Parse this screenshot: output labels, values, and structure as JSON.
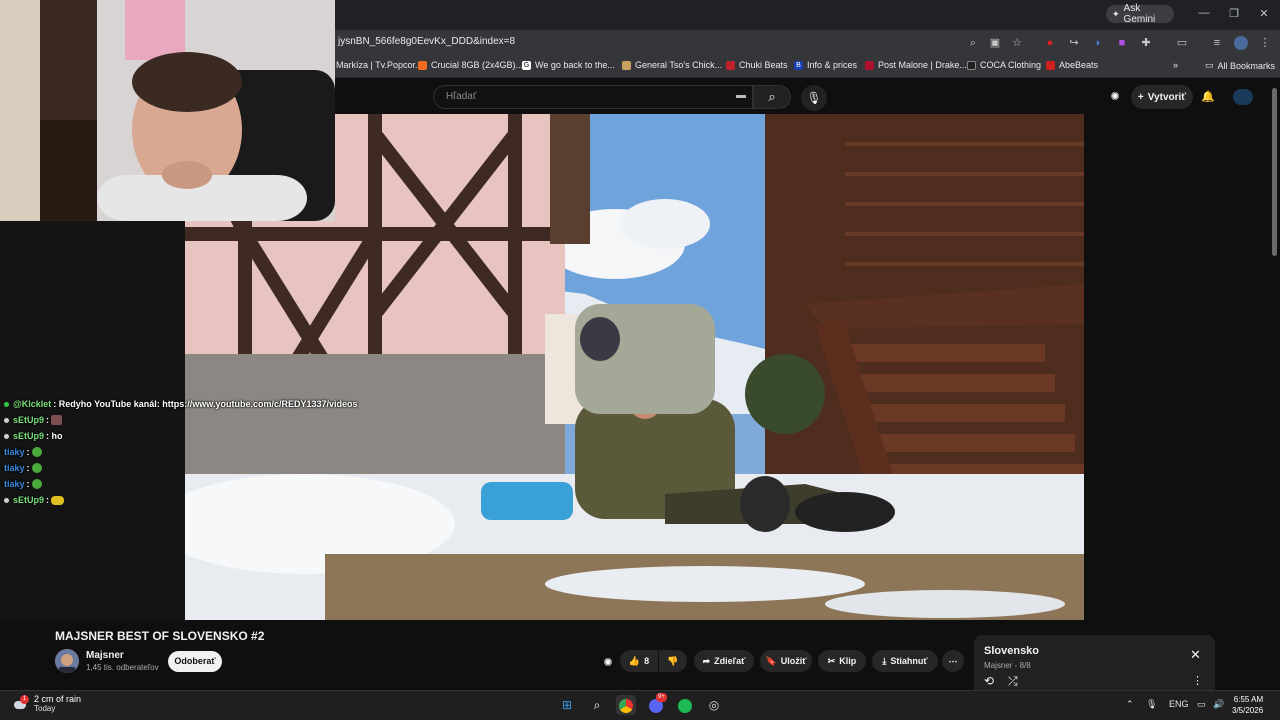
{
  "browser": {
    "url": "jysnBN_566fe8g0EevKx_DDD&index=8",
    "ask_gemini": "Ask Gemini",
    "bookmarks": [
      {
        "label": "Markíza | Tv.Popcor...",
        "color": "#1a1a1a"
      },
      {
        "label": "Crucial 8GB (2x4GB)...",
        "color": "#f26b21"
      },
      {
        "label": "We go back to the...",
        "color": "#ffffff"
      },
      {
        "label": "General Tso's Chick...",
        "color": "#c8a060"
      },
      {
        "label": "Chuki Beats",
        "color": "#c0202a"
      },
      {
        "label": "Info & prices",
        "color": "#1a3fb0"
      },
      {
        "label": "Post Malone | Drake...",
        "color": "#b01030"
      },
      {
        "label": "COCA Clothing",
        "color": "#202020"
      },
      {
        "label": "AbeBeats",
        "color": "#d02020"
      }
    ],
    "all_bookmarks": "All Bookmarks"
  },
  "youtube": {
    "search_placeholder": "Hľadať",
    "create_label": "Vytvoriť",
    "video_title": "MAJSNER BEST OF SLOVENSKO #2",
    "channel_name": "Majsner",
    "subscribers": "1,45 tis. odberateľov",
    "subscribe_label": "Odoberať",
    "likes": "8",
    "share_label": "Zdieľať",
    "save_label": "Uložiť",
    "clip_label": "Klip",
    "download_label": "Stiahnuť",
    "playlist": {
      "title": "Slovensko",
      "sub": "Majsner - 8/8"
    }
  },
  "chat": [
    {
      "user": "@Klcklet",
      "user_color": "#7be07b",
      "dot": "#2ecc40",
      "text": " : Redyho YouTube kanál: https://www.youtube.com/c/REDY1337/videos",
      "emote": ""
    },
    {
      "user": "sEtUp9",
      "user_color": "#7be07b",
      "dot": "#d0d0d0",
      "text": " : ",
      "emote": "img"
    },
    {
      "user": "sEtUp9",
      "user_color": "#7be07b",
      "dot": "#d0d0d0",
      "text": " : ho",
      "emote": ""
    },
    {
      "user": "tiaky",
      "user_color": "#3a8be0",
      "dot": "#2ecc40",
      "text": " : ",
      "emote": "pepe"
    },
    {
      "user": "tiaky",
      "user_color": "#3a8be0",
      "dot": "",
      "text": " : ",
      "emote": "pepe"
    },
    {
      "user": "tiaky",
      "user_color": "#3a8be0",
      "dot": "",
      "text": " : ",
      "emote": "pepe"
    },
    {
      "user": "sEtUp9",
      "user_color": "#7be07b",
      "dot": "#d0d0d0",
      "text": " : ",
      "emote": "yellow"
    }
  ],
  "taskbar": {
    "weather_line1": "2 cm of rain",
    "weather_line2": "Today",
    "weather_badge": "1",
    "lang": "ENG",
    "time": "6:55 AM",
    "date": "3/5/2026",
    "discord_badge": "9+"
  }
}
